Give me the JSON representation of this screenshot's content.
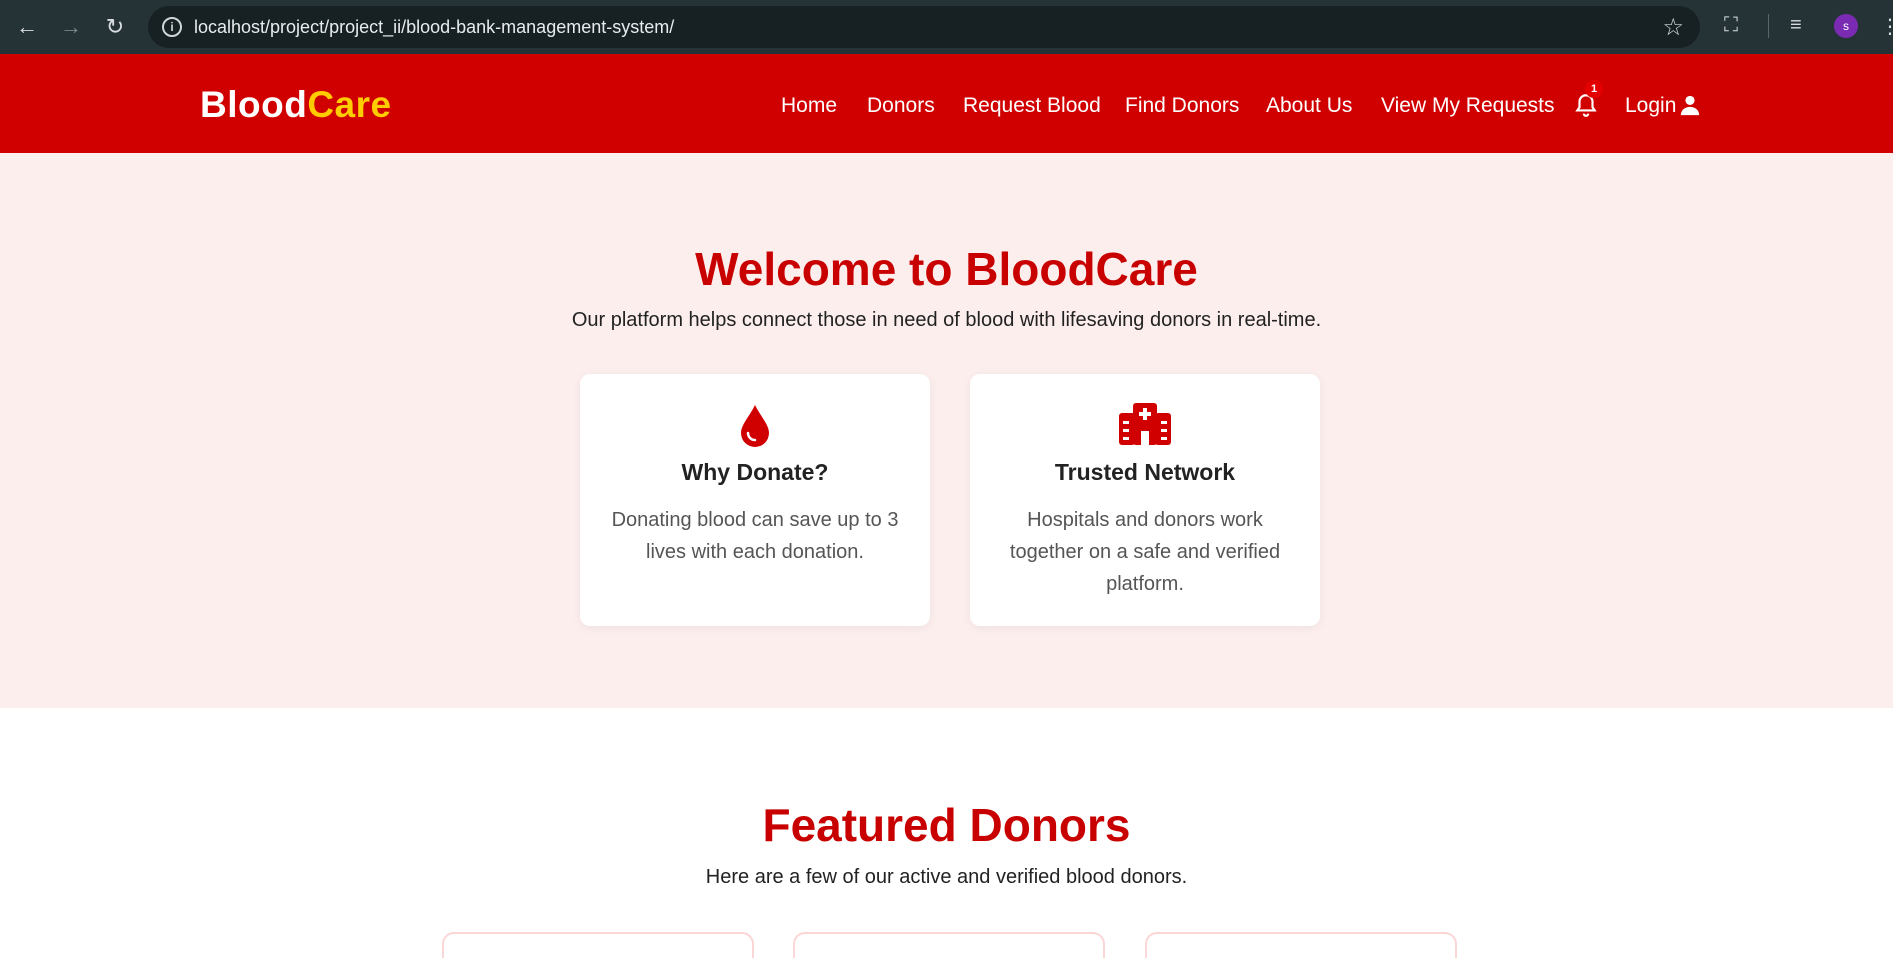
{
  "browser": {
    "url": "localhost/project/project_ii/blood-bank-management-system/",
    "profile_initial": "s"
  },
  "header": {
    "logo_part1": "Blood",
    "logo_part2": "Care",
    "nav": {
      "home": "Home",
      "donors": "Donors",
      "request_blood": "Request Blood",
      "find_donors": "Find Donors",
      "about_us": "About Us",
      "view_requests": "View My Requests",
      "login": "Login"
    },
    "notification_count": "1"
  },
  "hero": {
    "title": "Welcome to BloodCare",
    "subtitle": "Our platform helps connect those in need of blood with lifesaving donors in real-time.",
    "cards": [
      {
        "icon": "blood-drop-icon",
        "title": "Why Donate?",
        "text": "Donating blood can save up to 3 lives with each donation."
      },
      {
        "icon": "hospital-icon",
        "title": "Trusted Network",
        "text": "Hospitals and donors work together on a safe and verified platform."
      }
    ]
  },
  "featured": {
    "title": "Featured Donors",
    "subtitle": "Here are a few of our active and verified blood donors."
  },
  "colors": {
    "brand_red": "#d10000",
    "accent_yellow": "#ffcc00",
    "hero_bg": "#fdeeee"
  }
}
